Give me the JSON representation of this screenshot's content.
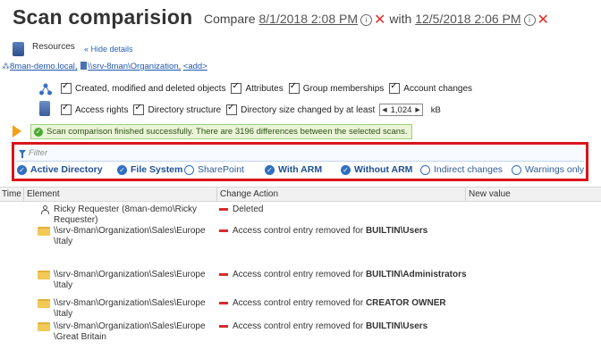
{
  "page": {
    "title": "Scan comparision",
    "compare_label": "Compare",
    "date1": "8/1/2018 2:08 PM",
    "with_label": "with",
    "date2": "12/5/2018 2:06 PM"
  },
  "resources": {
    "label": "Resources",
    "hide_link": "« Hide details",
    "path_domain": "8man-demo.local,",
    "path_server": "\\\\srv-8man\\Organization,",
    "path_add": "<add>"
  },
  "options_ad": [
    "Created, modified and deleted objects",
    "Attributes",
    "Group memberships",
    "Account changes"
  ],
  "options_fs": {
    "items": [
      "Access rights",
      "Directory structure",
      "Directory size changed by at least"
    ],
    "size_value": "1,024",
    "size_unit": "kB"
  },
  "status": {
    "message": "Scan comparison finished successfully. There are 3196 differences between the selected scans."
  },
  "filter": {
    "placeholder": "Filter",
    "options": [
      {
        "label": "Active Directory",
        "selected": true
      },
      {
        "label": "File System",
        "selected": true
      },
      {
        "label": "SharePoint",
        "selected": false
      },
      {
        "label": "With ARM",
        "selected": true
      },
      {
        "label": "Without ARM",
        "selected": true
      },
      {
        "label": "Indirect changes",
        "selected": false
      },
      {
        "label": "Warnings only",
        "selected": false
      }
    ]
  },
  "grid": {
    "headers": [
      "Time",
      "Element",
      "Change Action",
      "New value"
    ],
    "rows": [
      {
        "icon": "user-icon",
        "element": "Ricky Requester (8man-demo\\Ricky Requester)",
        "action_prefix": "Deleted",
        "action_bold": ""
      },
      {
        "icon": "folder-icon",
        "element": "\\\\srv-8man\\Organization\\Sales\\Europe \\Italy",
        "action_prefix": "Access control entry removed for ",
        "action_bold": "BUILTIN\\Users"
      },
      {
        "icon": "folder-icon",
        "element": "\\\\srv-8man\\Organization\\Sales\\Europe \\Italy",
        "action_prefix": "Access control entry removed for ",
        "action_bold": "BUILTIN\\Administrators"
      },
      {
        "icon": "folder-icon",
        "element": "\\\\srv-8man\\Organization\\Sales\\Europe \\Italy",
        "action_prefix": "Access control entry removed for ",
        "action_bold": "CREATOR OWNER"
      },
      {
        "icon": "folder-icon",
        "element": "\\\\srv-8man\\Organization\\Sales\\Europe \\Great Britain",
        "action_prefix": "Access control entry removed for ",
        "action_bold": "BUILTIN\\Users"
      }
    ]
  }
}
